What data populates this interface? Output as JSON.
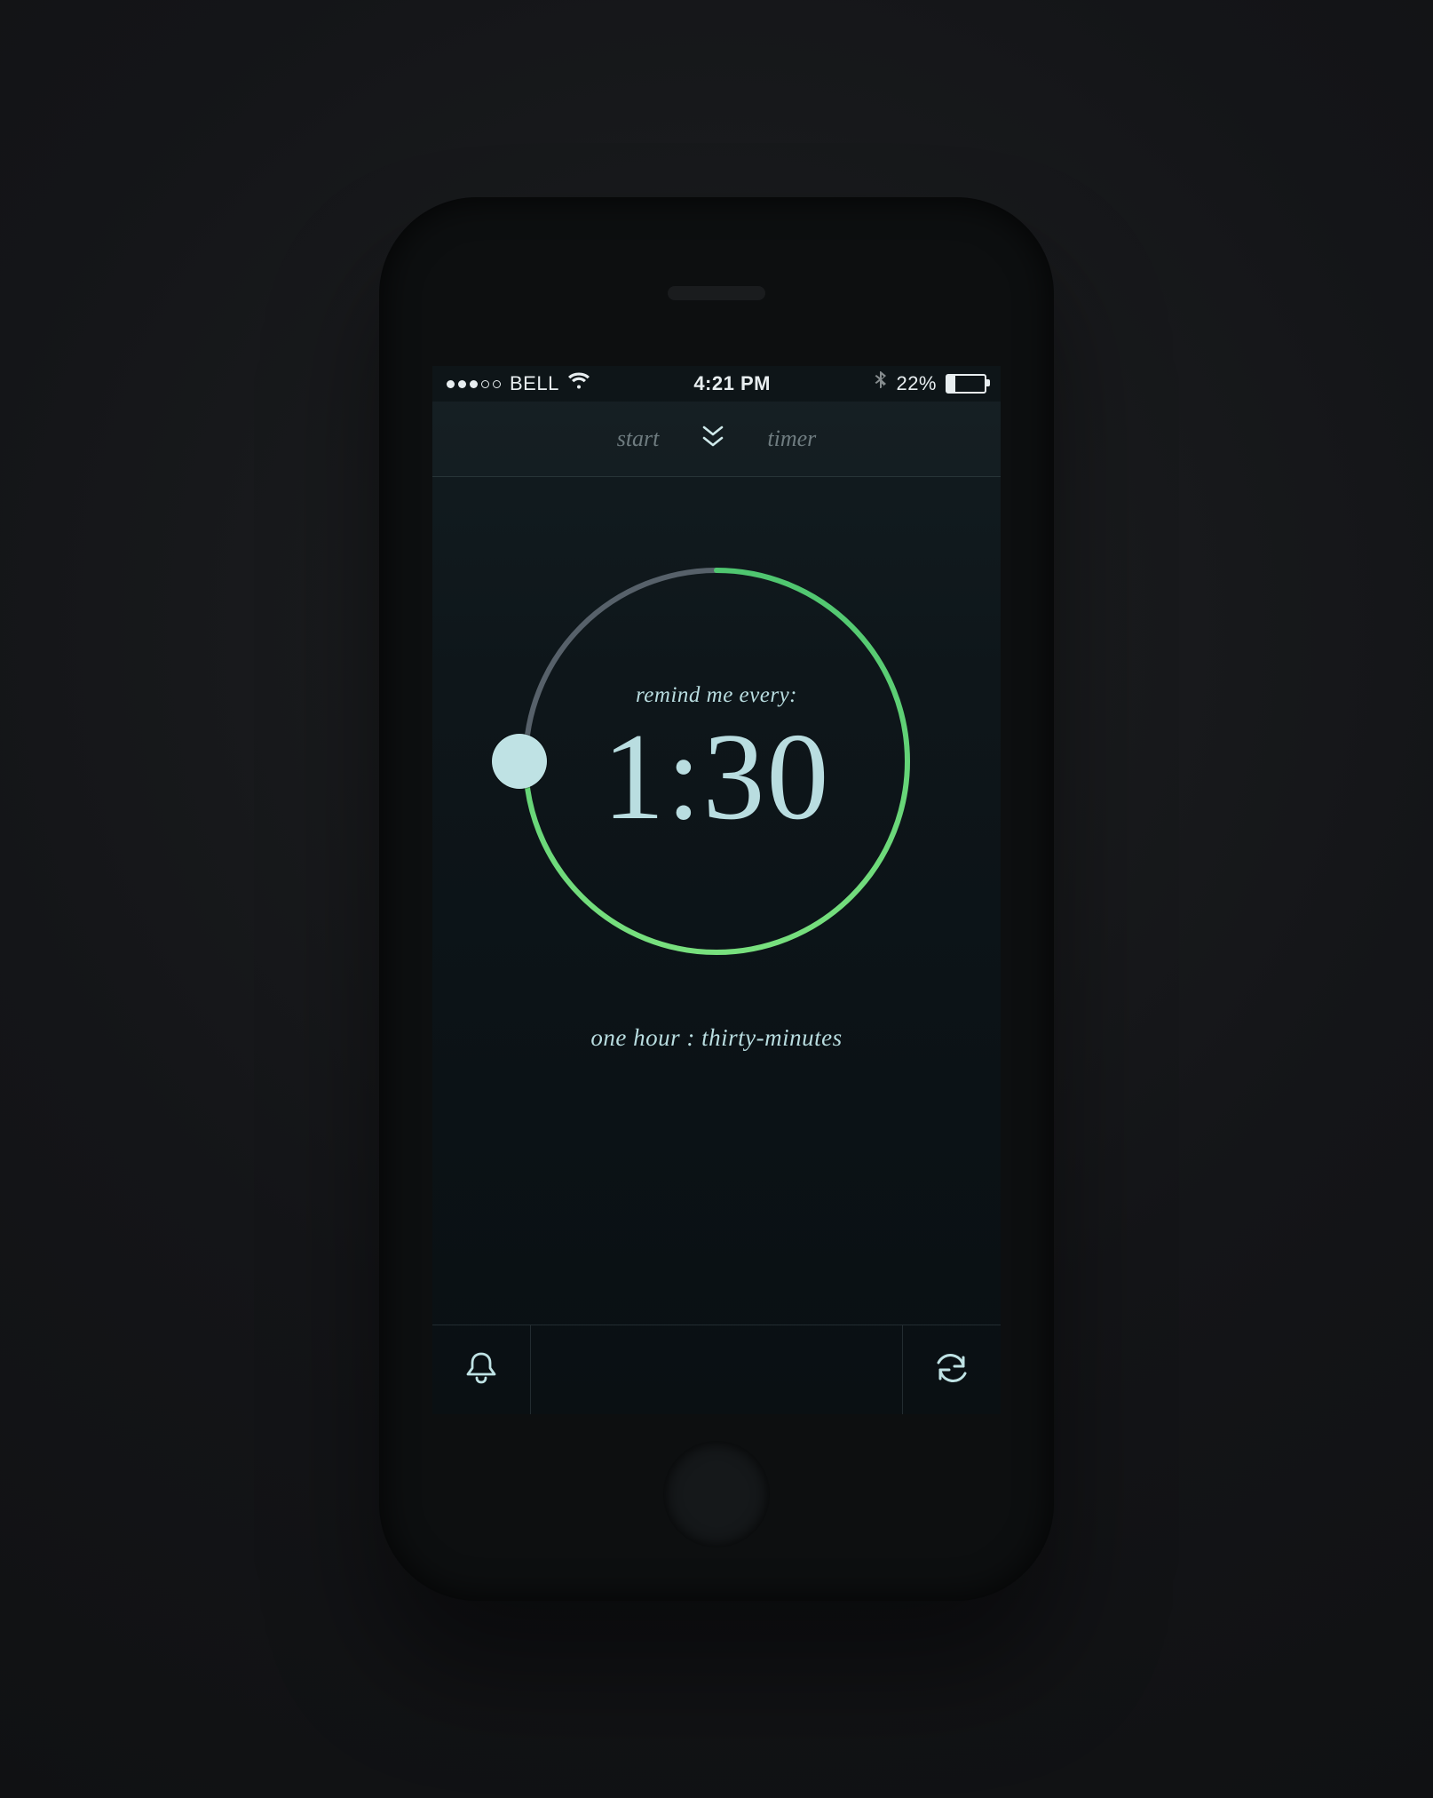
{
  "statusbar": {
    "carrier": "BELL",
    "time": "4:21 PM",
    "battery_pct": "22%"
  },
  "header": {
    "left": "start",
    "right": "timer"
  },
  "dial": {
    "label": "remind me every:",
    "value": "1:30",
    "in_words": "one hour : thirty-minutes",
    "progress_start_deg": -90,
    "handle_deg": 270,
    "track_color": "#57616a",
    "fill_color_start": "#4fc670",
    "fill_color_end": "#78e07e"
  },
  "colors": {
    "accent_text": "#b9dde0",
    "handle": "#bfe2e4"
  },
  "icons": {
    "bell": "bell-icon",
    "repeat": "repeat-icon",
    "wifi": "wifi-icon",
    "bluetooth": "bluetooth-icon",
    "chevrons": "chevrons-down-icon"
  }
}
